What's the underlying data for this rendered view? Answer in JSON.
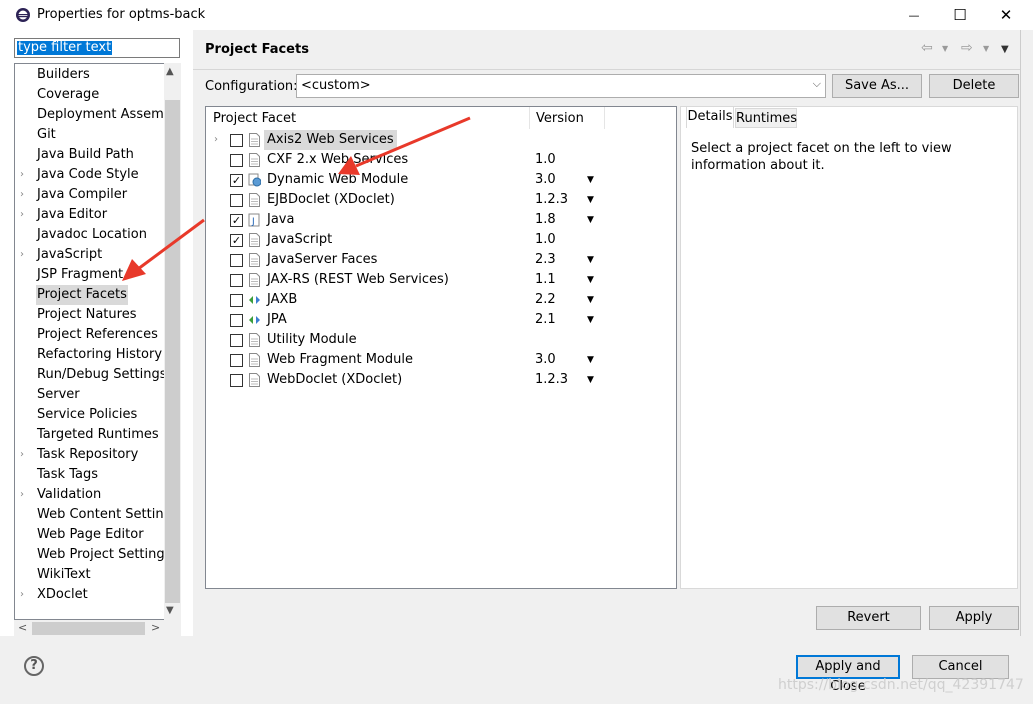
{
  "window": {
    "title": "Properties for optms-back",
    "minimize_glyph": "—",
    "maximize_glyph": "☐",
    "close_glyph": "✕"
  },
  "filter": {
    "text": "type filter text"
  },
  "tree": {
    "items": [
      {
        "label": "Builders",
        "expandable": false
      },
      {
        "label": "Coverage",
        "expandable": false
      },
      {
        "label": "Deployment Assembly",
        "expandable": false
      },
      {
        "label": "Git",
        "expandable": false
      },
      {
        "label": "Java Build Path",
        "expandable": false
      },
      {
        "label": "Java Code Style",
        "expandable": true
      },
      {
        "label": "Java Compiler",
        "expandable": true
      },
      {
        "label": "Java Editor",
        "expandable": true
      },
      {
        "label": "Javadoc Location",
        "expandable": false
      },
      {
        "label": "JavaScript",
        "expandable": true
      },
      {
        "label": "JSP Fragment",
        "expandable": false
      },
      {
        "label": "Project Facets",
        "expandable": false,
        "selected": true
      },
      {
        "label": "Project Natures",
        "expandable": false
      },
      {
        "label": "Project References",
        "expandable": false
      },
      {
        "label": "Refactoring History",
        "expandable": false
      },
      {
        "label": "Run/Debug Settings",
        "expandable": false
      },
      {
        "label": "Server",
        "expandable": false
      },
      {
        "label": "Service Policies",
        "expandable": false
      },
      {
        "label": "Targeted Runtimes",
        "expandable": false
      },
      {
        "label": "Task Repository",
        "expandable": true
      },
      {
        "label": "Task Tags",
        "expandable": false
      },
      {
        "label": "Validation",
        "expandable": true
      },
      {
        "label": "Web Content Settings",
        "expandable": false
      },
      {
        "label": "Web Page Editor",
        "expandable": false
      },
      {
        "label": "Web Project Settings",
        "expandable": false
      },
      {
        "label": "WikiText",
        "expandable": false
      },
      {
        "label": "XDoclet",
        "expandable": true
      }
    ]
  },
  "panel": {
    "title": "Project Facets",
    "config_label": "Configuration:",
    "config_value": "<custom>",
    "save_as": "Save As...",
    "delete": "Delete",
    "col_facet": "Project Facet",
    "col_version": "Version",
    "facets": [
      {
        "name": "Axis2 Web Services",
        "version": "",
        "checked": false,
        "icon": "page",
        "expandable": true,
        "highlight": true,
        "dropdown": false
      },
      {
        "name": "CXF 2.x Web Services",
        "version": "1.0",
        "checked": false,
        "icon": "page",
        "expandable": false,
        "dropdown": false
      },
      {
        "name": "Dynamic Web Module",
        "version": "3.0",
        "checked": true,
        "icon": "web",
        "expandable": false,
        "dropdown": true
      },
      {
        "name": "EJBDoclet (XDoclet)",
        "version": "1.2.3",
        "checked": false,
        "icon": "page",
        "expandable": false,
        "dropdown": true
      },
      {
        "name": "Java",
        "version": "1.8",
        "checked": true,
        "icon": "java",
        "expandable": false,
        "dropdown": true
      },
      {
        "name": "JavaScript",
        "version": "1.0",
        "checked": true,
        "icon": "page",
        "expandable": false,
        "dropdown": false
      },
      {
        "name": "JavaServer Faces",
        "version": "2.3",
        "checked": false,
        "icon": "page",
        "expandable": false,
        "dropdown": true
      },
      {
        "name": "JAX-RS (REST Web Services)",
        "version": "1.1",
        "checked": false,
        "icon": "page",
        "expandable": false,
        "dropdown": true
      },
      {
        "name": "JAXB",
        "version": "2.2",
        "checked": false,
        "icon": "jaxb",
        "expandable": false,
        "dropdown": true
      },
      {
        "name": "JPA",
        "version": "2.1",
        "checked": false,
        "icon": "jaxb",
        "expandable": false,
        "dropdown": true
      },
      {
        "name": "Utility Module",
        "version": "",
        "checked": false,
        "icon": "page",
        "expandable": false,
        "dropdown": false
      },
      {
        "name": "Web Fragment Module",
        "version": "3.0",
        "checked": false,
        "icon": "page",
        "expandable": false,
        "dropdown": true
      },
      {
        "name": "WebDoclet (XDoclet)",
        "version": "1.2.3",
        "checked": false,
        "icon": "page",
        "expandable": false,
        "dropdown": true
      }
    ],
    "tabs": {
      "details": "Details",
      "runtimes": "Runtimes"
    },
    "details_text": "Select a project facet on the left to view information about it.",
    "revert": "Revert",
    "apply": "Apply"
  },
  "footer": {
    "help": "?",
    "apply_close": "Apply and Close",
    "cancel": "Cancel",
    "watermark": "https://blog.csdn.net/qq_42391747"
  },
  "colors": {
    "selection": "#0078d7",
    "arrow": "#e8392a"
  }
}
